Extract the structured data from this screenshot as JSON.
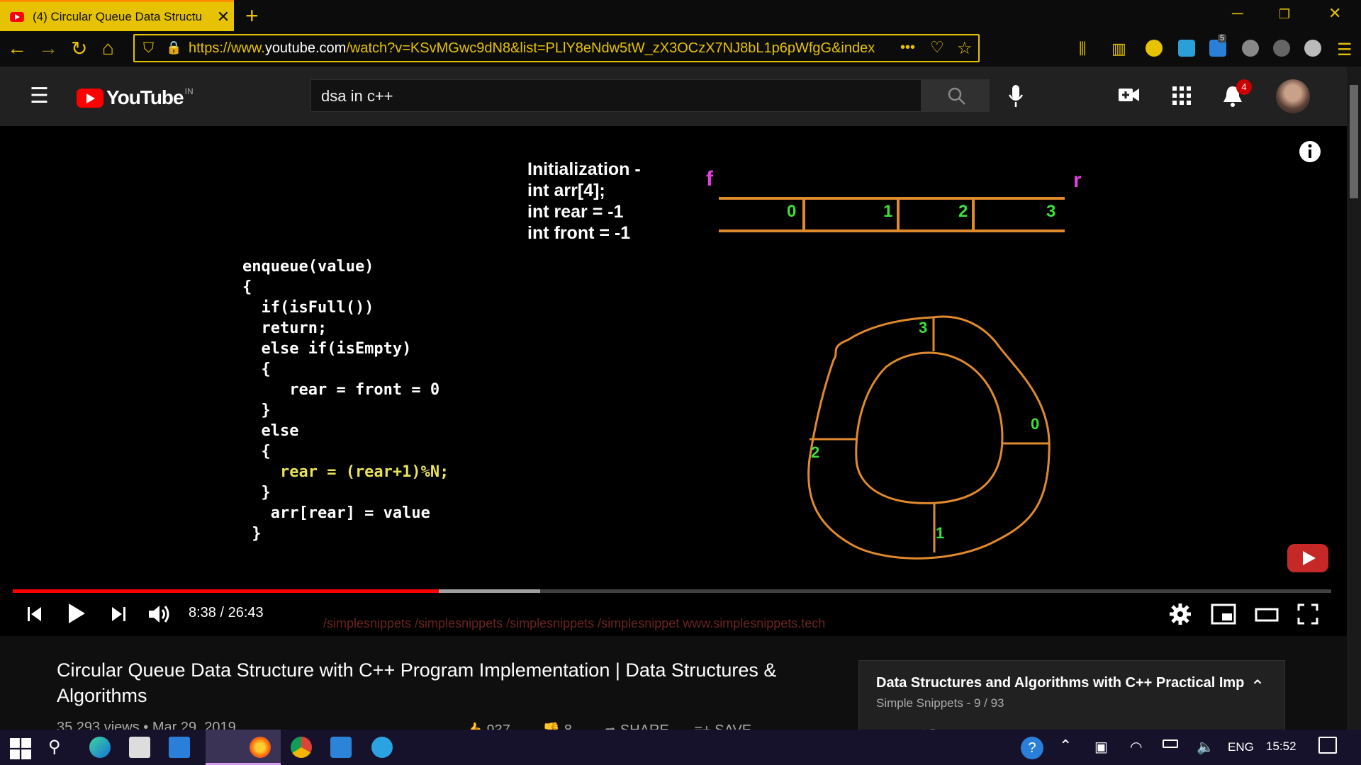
{
  "browser": {
    "tab_title": "(4) Circular Queue Data Structu",
    "url_prefix": "https://www.",
    "url_domain": "youtube.com",
    "url_rest": "/watch?v=KSvMGwc9dN8&list=PLlY8eNdw5tW_zX3OCzX7NJ8bL1p6pWfgG&index"
  },
  "youtube": {
    "logo_word": "YouTube",
    "region": "IN",
    "search_value": "dsa in c++",
    "notification_count": "4",
    "extension_badge": "5"
  },
  "video": {
    "init_lines": [
      "Initialization -",
      "int arr[4];",
      "int rear = -1",
      "int front = -1"
    ],
    "array_indices": [
      "0",
      "1",
      "2",
      "3"
    ],
    "front_label": "f",
    "rear_label": "r",
    "ring_indices": [
      "3",
      "0",
      "1",
      "2"
    ],
    "code": {
      "l1": "enqueue(value)",
      "l2": "{",
      "l3": "  if(isFull())",
      "l4": "  return;",
      "l5": "  else if(isEmpty)",
      "l6": "  {",
      "l7": "     rear = front = 0",
      "l8": "  }",
      "l9": "  else",
      "l10": "  {",
      "l11": "    rear = (rear+1)%N;",
      "l12": "  }",
      "l13": "   arr[rear] = value",
      "l14": " }"
    },
    "time": "8:38 / 26:43",
    "progress_played": 0.323,
    "progress_buffered": 0.4,
    "social": "/simplesnippets   /simplesnippets   /simplesnippets   /simplesnippet   www.simplesnippets.tech"
  },
  "page": {
    "title": "Circular Queue Data Structure with C++ Program Implementation | Data Structures & Algorithms",
    "views": "35,293 views • Mar 29, 2019",
    "likes": "937",
    "dislikes": "8",
    "share": "SHARE",
    "save": "SAVE",
    "playlist_title": "Data Structures and Algorithms with C++ Practical Impl",
    "playlist_sub": "Simple Snippets - 9 / 93"
  },
  "taskbar": {
    "lang": "ENG",
    "clock": "15:52"
  },
  "colors": {
    "accent": "#e6c200",
    "orange": "#e08a2e",
    "green": "#3be03b",
    "magenta": "#e040e0",
    "red": "#ff0000"
  }
}
